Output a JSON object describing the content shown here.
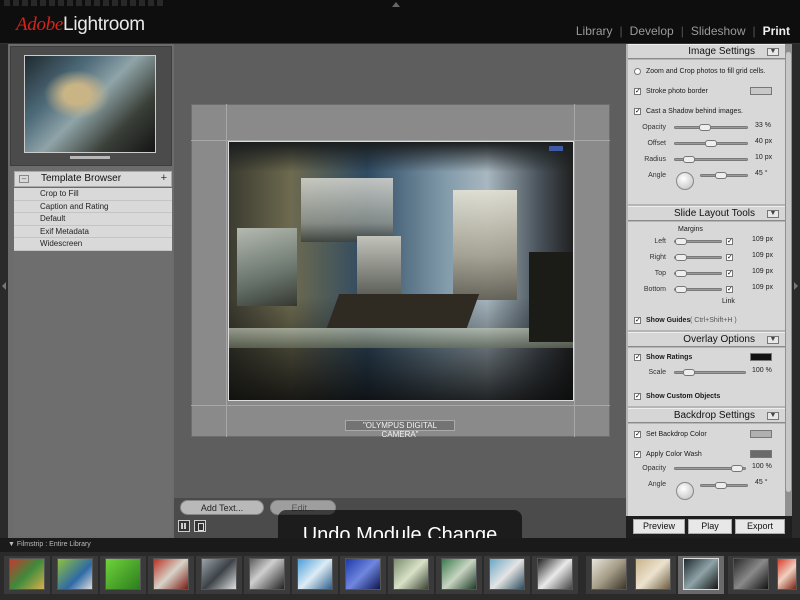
{
  "app": {
    "logo_adobe": "Adobe",
    "logo_product": "Lightroom",
    "modules": [
      "Library",
      "Develop",
      "Slideshow",
      "Print"
    ],
    "active_module": "Print"
  },
  "left_panel": {
    "template_browser_title": "Template Browser",
    "templates": [
      "Crop to Fill",
      "Caption and Rating",
      "Default",
      "Exif Metadata",
      "Widescreen"
    ]
  },
  "center": {
    "photo_caption": "\"OLYMPUS DIGITAL CAMERA\"",
    "add_text_label": "Add Text...",
    "edit_label": "Edit..."
  },
  "hud": {
    "message": "Undo Module Change"
  },
  "image_settings": {
    "title": "Image Settings",
    "zoom_crop_label": "Zoom and Crop photos to fill grid cells.",
    "stroke_label": "Stroke photo border",
    "shadow_label": "Cast a Shadow behind images.",
    "opacity_label": "Opacity",
    "opacity_value": "33 %",
    "offset_label": "Offset",
    "offset_value": "40 px",
    "radius_label": "Radius",
    "radius_value": "10 px",
    "angle_label": "Angle",
    "angle_value": "45 °"
  },
  "slide_layout": {
    "title": "Slide Layout Tools",
    "margins_label": "Margins",
    "left_label": "Left",
    "left_value": "109 px",
    "right_label": "Right",
    "right_value": "109 px",
    "top_label": "Top",
    "top_value": "109 px",
    "bottom_label": "Bottom",
    "bottom_value": "109 px",
    "link_label": "Link",
    "show_guides_label": "Show Guides",
    "show_guides_shortcut": "( Ctrl+Shift+H )"
  },
  "overlay_options": {
    "title": "Overlay Options",
    "show_ratings_label": "Show Ratings",
    "scale_label": "Scale",
    "scale_value": "100 %",
    "show_custom_label": "Show Custom Objects"
  },
  "backdrop_settings": {
    "title": "Backdrop Settings",
    "set_color_label": "Set Backdrop Color",
    "color_wash_label": "Apply Color Wash",
    "opacity_label": "Opacity",
    "opacity_value": "100 %",
    "angle_label": "Angle",
    "angle_value": "45 °"
  },
  "right_buttons": {
    "preview": "Preview",
    "play": "Play",
    "export": "Export"
  },
  "filmstrip": {
    "label": "Filmstrip",
    "source": "Entire Library"
  },
  "colors": {
    "accent_red": "#d2261c",
    "panel_light": "#d8d8d8",
    "bg_dark": "#0e0e0e"
  }
}
